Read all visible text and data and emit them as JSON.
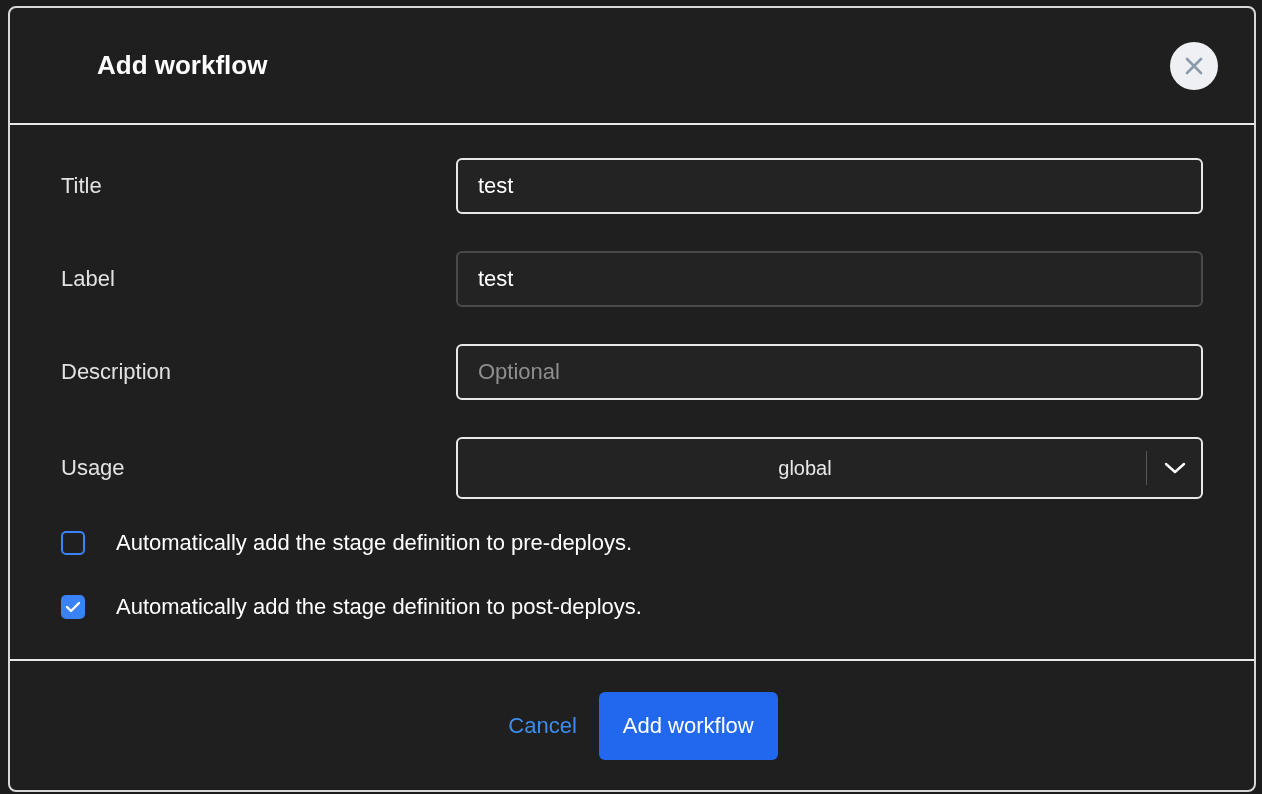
{
  "dialog": {
    "title": "Add workflow",
    "fields": [
      {
        "kind": "text",
        "label": "Title",
        "value": "test",
        "focused": true
      },
      {
        "kind": "text",
        "label": "Label",
        "value": "test",
        "focused": false
      },
      {
        "kind": "text",
        "label": "Description",
        "placeholder": "Optional",
        "focused": true
      },
      {
        "kind": "select",
        "label": "Usage",
        "value": "global",
        "focused": true
      }
    ],
    "checkboxes": [
      {
        "label": "Automatically add the stage definition to pre-deploys.",
        "checked": false
      },
      {
        "label": "Automatically add the stage definition to post-deploys.",
        "checked": true
      }
    ],
    "buttons": [
      {
        "kind": "link",
        "label": "Cancel"
      },
      {
        "kind": "primary",
        "label": "Add workflow"
      }
    ]
  }
}
